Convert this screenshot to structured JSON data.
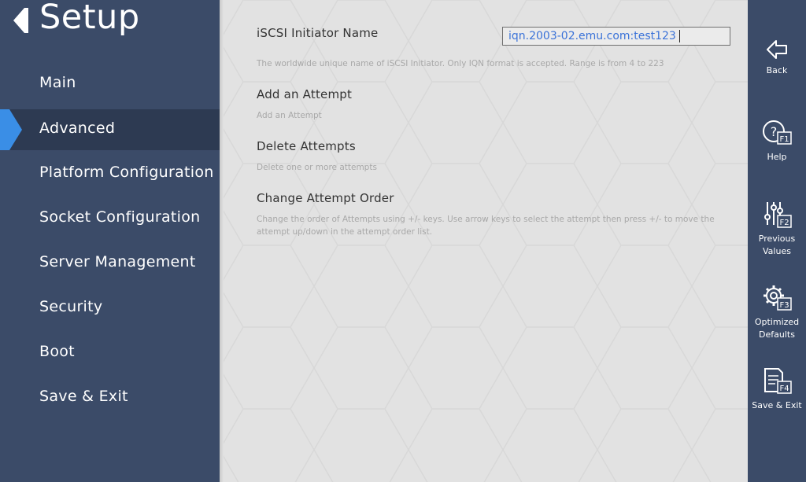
{
  "app": {
    "title": "Setup"
  },
  "sidebar": {
    "items": [
      {
        "label": "Main",
        "active": false
      },
      {
        "label": "Advanced",
        "active": true
      },
      {
        "label": "Platform Configuration",
        "active": false
      },
      {
        "label": "Socket Configuration",
        "active": false
      },
      {
        "label": "Server Management",
        "active": false
      },
      {
        "label": "Security",
        "active": false
      },
      {
        "label": "Boot",
        "active": false
      },
      {
        "label": "Save & Exit",
        "active": false
      }
    ]
  },
  "main": {
    "iscsi_name": {
      "label": "iSCSI Initiator Name",
      "value": "iqn.2003-02.emu.com:test123",
      "help": "The worldwide unique name of iSCSI Initiator. Only IQN format is accepted. Range is from 4 to 223"
    },
    "add_attempt": {
      "label": "Add an Attempt",
      "help": "Add an Attempt"
    },
    "delete_attempts": {
      "label": "Delete Attempts",
      "help": "Delete one or more attempts"
    },
    "change_order": {
      "label": "Change Attempt Order",
      "help": "Change the order of Attempts using +/- keys. Use arrow keys to select the attempt then press +/- to move the attempt up/down in the attempt order list."
    }
  },
  "fnbar": {
    "back": {
      "label": "Back",
      "icon": "back-arrow-icon"
    },
    "help": {
      "label": "Help",
      "icon": "help-icon",
      "key": "F1"
    },
    "previous": {
      "label": "Previous Values",
      "icon": "sliders-icon",
      "key": "F2"
    },
    "optimized": {
      "label": "Optimized Defaults",
      "icon": "gear-icon",
      "key": "F3"
    },
    "save": {
      "label": "Save & Exit",
      "icon": "document-icon",
      "key": "F4"
    }
  },
  "colors": {
    "sidebar_bg": "#3b4b68",
    "active_bg": "#2d3a52",
    "accent": "#3a8ee6",
    "content_bg": "#e2e2e2",
    "input_text": "#3a72d8"
  }
}
